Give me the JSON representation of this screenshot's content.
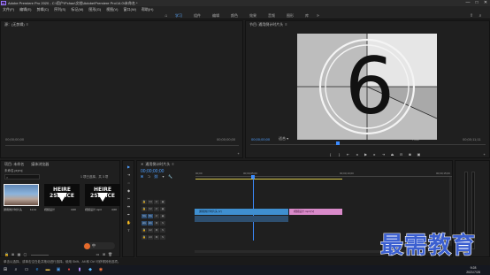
{
  "app": {
    "title": "Adobe Premiere Pro 2020 - C:\\用户\\Pchao\\文档\\Adobe\\Premiere Pro\\14.0\\未命名 *",
    "window_controls": [
      "—",
      "□",
      "✕"
    ]
  },
  "menu": [
    "文件(F)",
    "编辑(E)",
    "剪辑(C)",
    "序列(S)",
    "标记(M)",
    "图形(G)",
    "视图(V)",
    "窗口(W)",
    "帮助(H)"
  ],
  "workspace": {
    "tabs": [
      "学习",
      "组件",
      "编辑",
      "颜色",
      "效果",
      "音频",
      "图形",
      "库"
    ],
    "active": "学习",
    "more": "»"
  },
  "source_panel": {
    "title": "源：(无剪辑)",
    "timecode_left": "00;00;00;00",
    "timecode_right": "00;00;00;00"
  },
  "program_panel": {
    "title": "节目: 通用倒计时片头",
    "timecode": "00;00;00;00",
    "fit": "适合",
    "quality": "完整",
    "duration": "00;00;11;11",
    "countdown_number": "6"
  },
  "project_panel": {
    "tabs": [
      "项目: 未命名",
      "媒体浏览器"
    ],
    "file": "未命名.prproj",
    "selection": "1 项已选择，共 3 项",
    "items": [
      {
        "name": "通用倒计时片头",
        "duration": "11;11"
      },
      {
        "name": "视频设计",
        "duration": "4;00"
      },
      {
        "name": "视频设计.mp4",
        "duration": "4;00"
      }
    ],
    "placeholder_text": "HEIRE 2SERICE"
  },
  "timeline": {
    "title": "通用倒计时片头",
    "timecode": "00;00;00;00",
    "ruler": [
      "00;00",
      "00;00;05;00",
      "00;00;10;00",
      "00;00;15;00"
    ],
    "video_tracks": [
      "V3",
      "V2",
      "V1"
    ],
    "audio_tracks": [
      "A1",
      "A2",
      "A3"
    ],
    "clips": {
      "v1_a": "通用倒计时片头 [V]",
      "v1_b": "视频设计.mp4 [V]"
    }
  },
  "tools": [
    "▶",
    "⇥",
    "⇔",
    "◆",
    "✂",
    "⇹",
    "✒",
    "✋",
    "T"
  ],
  "status": {
    "message": "单击以选择，或单击空白处并拖动进行选择。使用 Shift、Alt 和 Ctrl 可获得其他选项。"
  },
  "taskbar": {
    "time": "9:28",
    "date": "2021/7/28",
    "ime": "中"
  },
  "watermark": "最需教育",
  "colors": {
    "accent_blue": "#4f9fff",
    "clip_video": "#3f8fd0",
    "clip_pink": "#d98ac9",
    "playhead": "#3b8bff",
    "work_bar": "#d8c84a"
  }
}
